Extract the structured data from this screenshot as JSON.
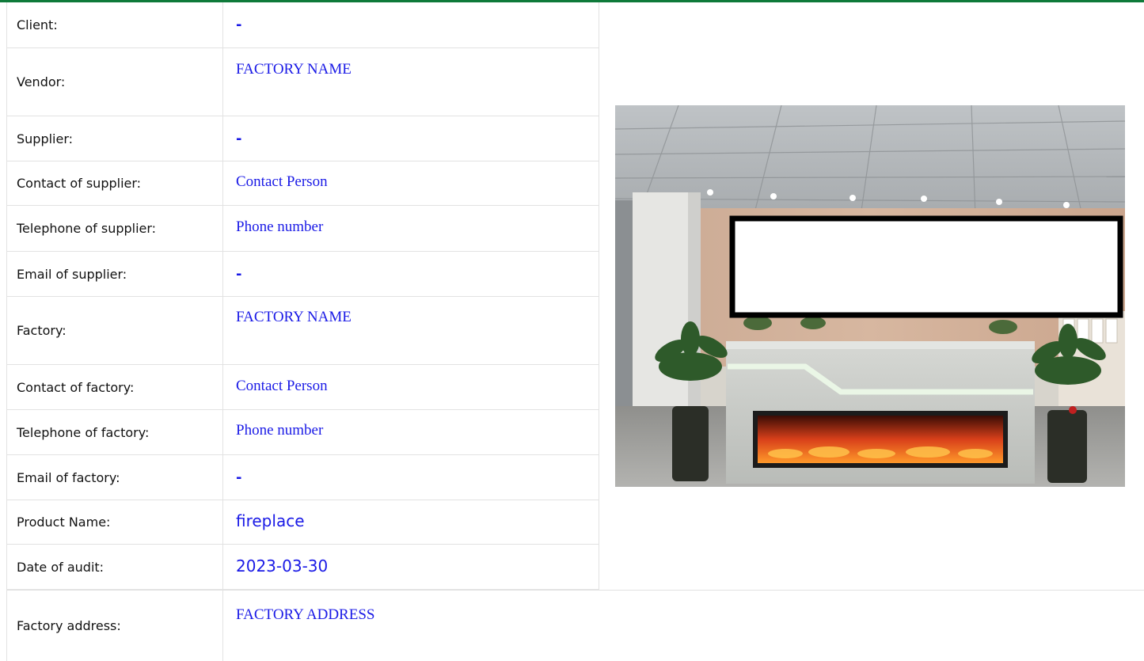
{
  "fields": [
    {
      "label": "Client:",
      "value": "-"
    },
    {
      "label": "Vendor:",
      "value": "FACTORY NAME"
    },
    {
      "label": "Supplier:",
      "value": "-"
    },
    {
      "label": "Contact of supplier:",
      "value": "Contact Person"
    },
    {
      "label": "Telephone of supplier:",
      "value": "Phone number"
    },
    {
      "label": "Email of supplier:",
      "value": "-"
    },
    {
      "label": "Factory:",
      "value": "FACTORY NAME"
    },
    {
      "label": "Contact of factory:",
      "value": "Contact Person"
    },
    {
      "label": "Telephone of factory:",
      "value": "Phone number"
    },
    {
      "label": "Email of factory:",
      "value": "-"
    },
    {
      "label": "Product Name:",
      "value": "fireplace"
    },
    {
      "label": "Date of audit:",
      "value": "2023-03-30"
    },
    {
      "label": "Factory address:",
      "value": "FACTORY ADDRESS"
    }
  ],
  "colors": {
    "accent_bar": "#0e7a3a",
    "value_text": "#1a1ae6",
    "label_text": "#111111",
    "grid_line": "#e2e2e2"
  }
}
